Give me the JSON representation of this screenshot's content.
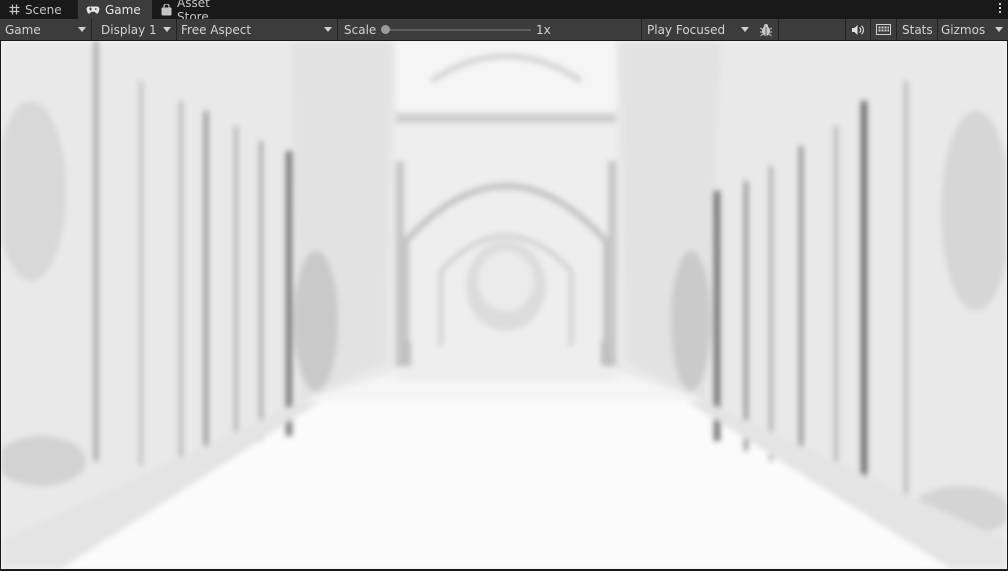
{
  "tabs": [
    {
      "label": "Scene",
      "icon": "grid-icon",
      "active": false
    },
    {
      "label": "Game",
      "icon": "gamepad-icon",
      "active": true
    },
    {
      "label": "Asset Store",
      "icon": "bag-icon",
      "active": false
    }
  ],
  "toolbar": {
    "view_select": "Game",
    "display_select": "Display 1",
    "aspect_select": "Free Aspect",
    "scale_label": "Scale",
    "scale_value": "1x",
    "scale_fraction": 0.0,
    "play_mode_select": "Play Focused",
    "stats_label": "Stats",
    "gizmos_label": "Gizmos"
  },
  "icons": {
    "bug": "bug-icon",
    "audio": "speaker-icon",
    "keyboard": "keyboard-icon",
    "more": "vertical-dots-icon"
  },
  "colors": {
    "tab_bar": "#191919",
    "toolbar": "#3c3c3c",
    "text": "#d2d2d2",
    "viewport": "#f4f4f4"
  }
}
